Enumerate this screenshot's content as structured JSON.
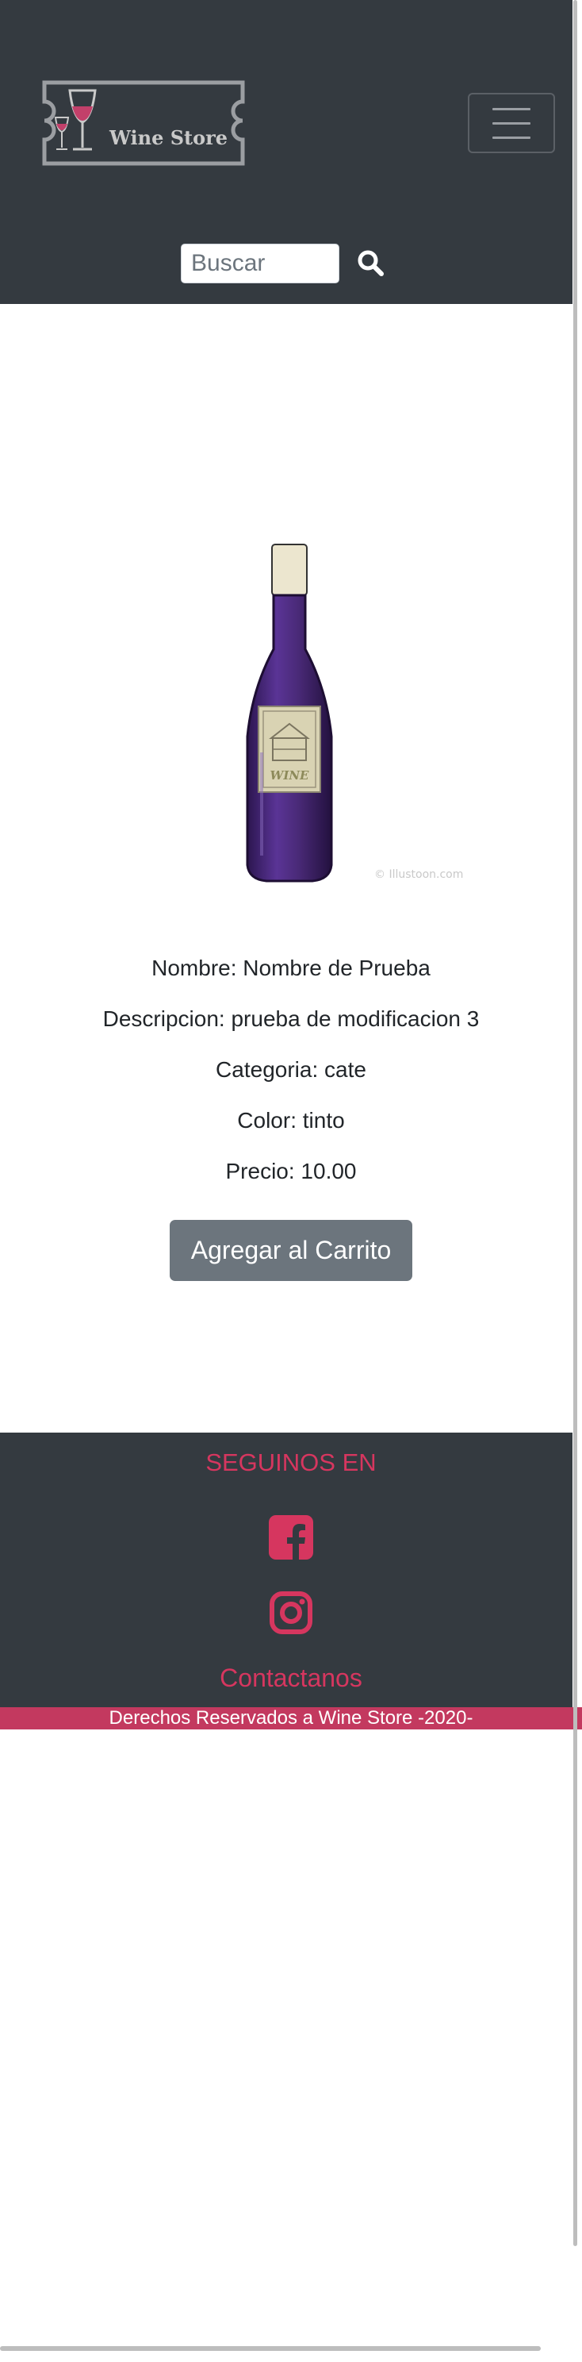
{
  "header": {
    "brand_name": "Wine Store",
    "search": {
      "placeholder": "Buscar",
      "value": ""
    },
    "search_icon": "search-icon",
    "menu_icon": "hamburger-icon"
  },
  "product": {
    "image_alt": "Botella de vino",
    "image_caption": "© Illustoon.com",
    "label_text": "WINE",
    "name": "Nombre: Nombre de Prueba",
    "description": "Descripcion: prueba de modificacion 3",
    "category": "Categoria: cate",
    "color": "Color: tinto",
    "price": "Precio: 10.00",
    "cart_button": "Agregar al Carrito"
  },
  "footer": {
    "follow_title": "SEGUINOS EN",
    "social": [
      {
        "icon": "facebook-icon"
      },
      {
        "icon": "instagram-icon"
      }
    ],
    "contact_link": "Contactanos",
    "copyright": "Derechos Reservados a Wine Store -2020-"
  },
  "colors": {
    "navbar_bg": "#343a40",
    "accent_pink": "#d6365f",
    "copyright_bg": "#c3395f",
    "button_gray": "#6c757d",
    "wine_purple": "#4a2a78"
  }
}
